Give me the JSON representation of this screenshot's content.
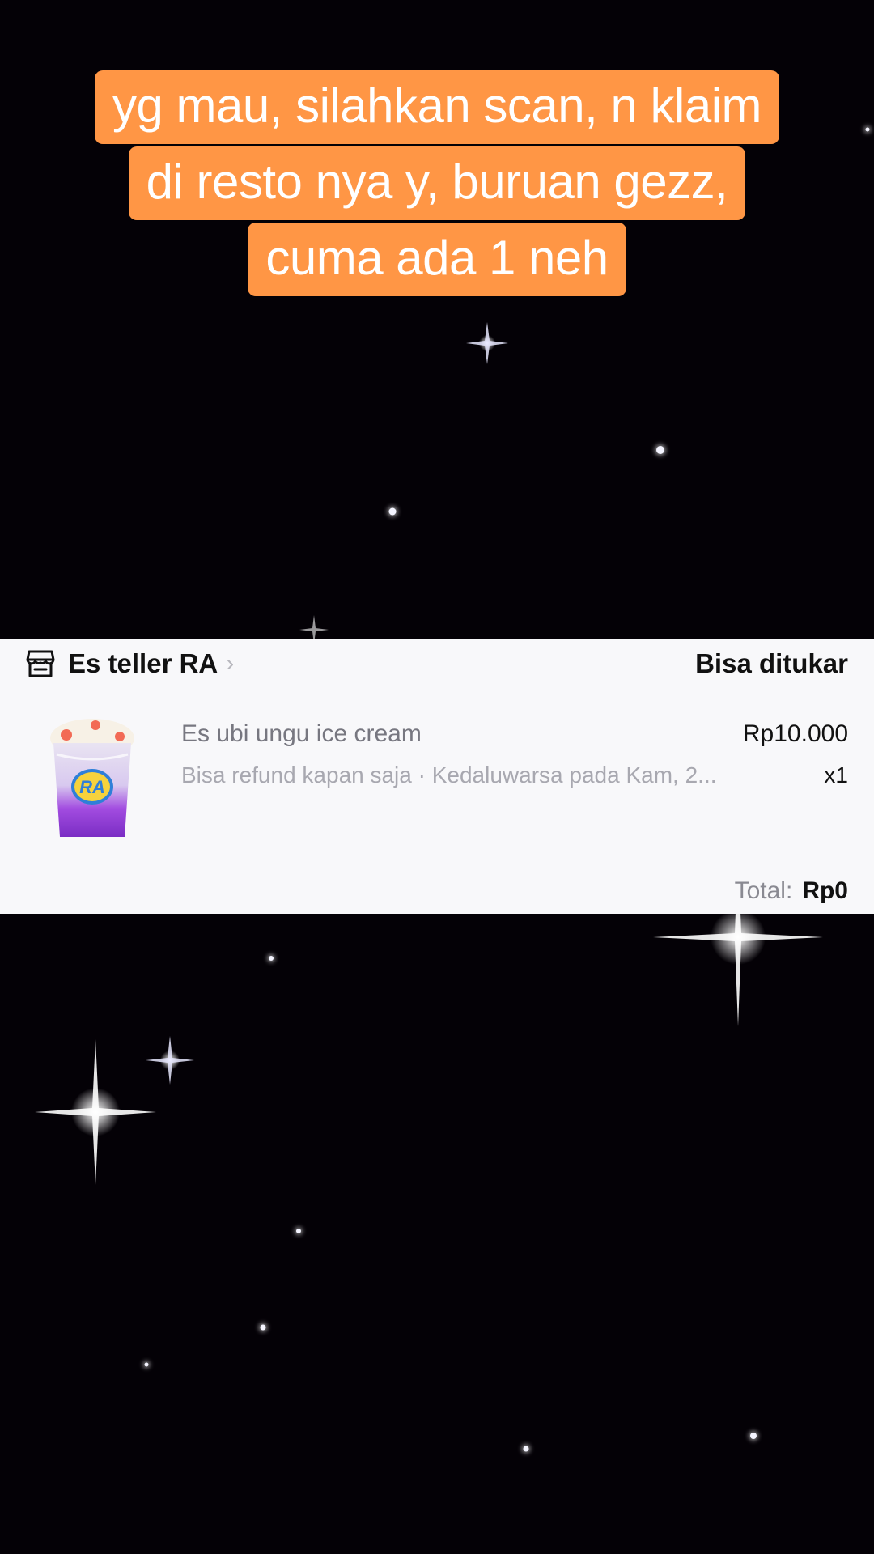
{
  "caption": {
    "lines": [
      "yg mau, silahkan scan, n klaim",
      "di resto nya y, buruan gezz,",
      "cuma ada 1 neh"
    ],
    "background_color": "#ff9645"
  },
  "order": {
    "shop_icon": "store-icon",
    "shop_name": "Es teller RA",
    "shop_chevron": "›",
    "status": "Bisa ditukar",
    "item": {
      "name": "Es ubi ungu ice cream",
      "price": "Rp10.000",
      "meta": "Bisa refund kapan saja · Kedaluwarsa pada Kam, 2...",
      "quantity": "x1",
      "thumbnail_logo_text": "RA"
    },
    "total_label": "Total:",
    "total_value": "Rp0"
  },
  "background": {
    "color": "#040106",
    "decoration": "sparkle-stars"
  }
}
